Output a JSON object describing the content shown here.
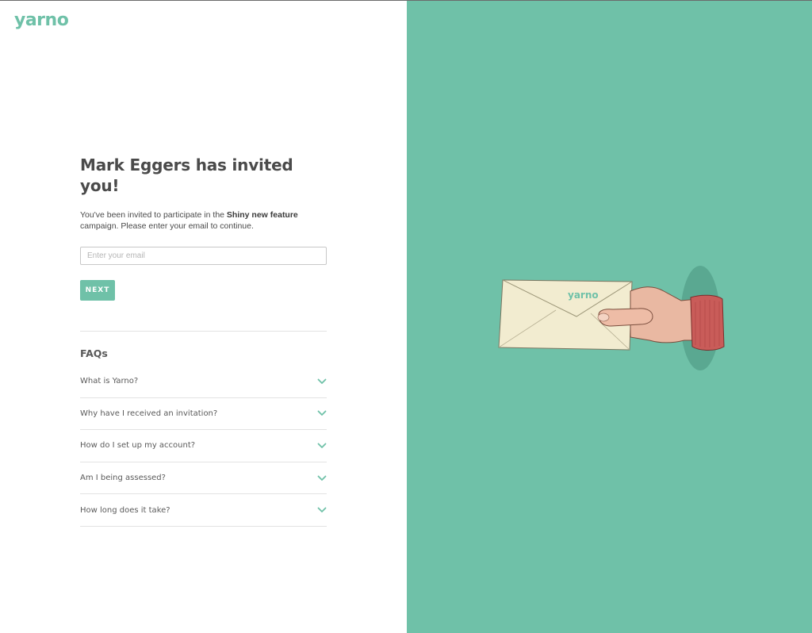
{
  "brand": {
    "logo_text": "yarno",
    "accent_color": "#6fc1a8"
  },
  "invite": {
    "heading": "Mark Eggers has invited you!",
    "intro_before": "You've been invited to participate in the ",
    "campaign_name": "Shiny new feature",
    "intro_after": " campaign. Please enter your email to continue."
  },
  "form": {
    "email_placeholder": "Enter your email",
    "email_value": "",
    "next_label": "NEXT"
  },
  "faqs": {
    "title": "FAQs",
    "items": [
      {
        "question": "What is Yarno?",
        "icon": "chevron-down-icon"
      },
      {
        "question": "Why have I received an invitation?",
        "icon": "chevron-down-icon"
      },
      {
        "question": "How do I set up my account?",
        "icon": "chevron-down-icon"
      },
      {
        "question": "Am I being assessed?",
        "icon": "chevron-down-icon"
      },
      {
        "question": "How long does it take?",
        "icon": "chevron-down-icon"
      }
    ]
  },
  "illustration": {
    "envelope_logo_text": "yarno",
    "icon": "hand-holding-envelope-icon"
  }
}
